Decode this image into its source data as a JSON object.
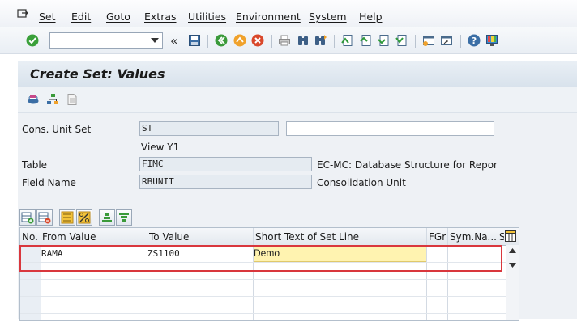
{
  "menu": {
    "items": [
      "Set",
      "Edit",
      "Goto",
      "Extras",
      "Utilities",
      "Environment",
      "System",
      "Help"
    ]
  },
  "toolbar": {
    "command_field_value": "",
    "icons": [
      "check-icon",
      "save-icon",
      "back-icon",
      "exit-icon",
      "cancel-icon",
      "print-icon",
      "find-icon",
      "find-next-icon",
      "first-page-icon",
      "previous-page-icon",
      "next-page-icon",
      "last-page-icon",
      "create-session-icon",
      "shortcut-icon",
      "help-icon",
      "customize-layout-icon"
    ]
  },
  "title": "Create Set: Values",
  "header": {
    "cons_unit_set_label": "Cons. Unit Set",
    "cons_unit_set_value": "ST",
    "cons_unit_set_desc": "",
    "view_label": "View Y1",
    "table_label": "Table",
    "table_value": "FIMC",
    "table_desc": "EC-MC: Database Structure for Reporti...",
    "field_name_label": "Field Name",
    "field_name_value": "RBUNIT",
    "field_name_desc": "Consolidation Unit"
  },
  "grid": {
    "columns": [
      "No.",
      "From Value",
      "To Value",
      "Short Text of Set Line",
      "FGr",
      "Sym.Na...",
      "S"
    ],
    "rows": [
      {
        "no": "",
        "from": "RAMA",
        "to": "ZS1100",
        "short_text": "Demo",
        "fgr": "",
        "sym": ""
      }
    ]
  },
  "colors": {
    "highlight_border": "#d9373d",
    "edit_cell": "#fff3b0"
  }
}
